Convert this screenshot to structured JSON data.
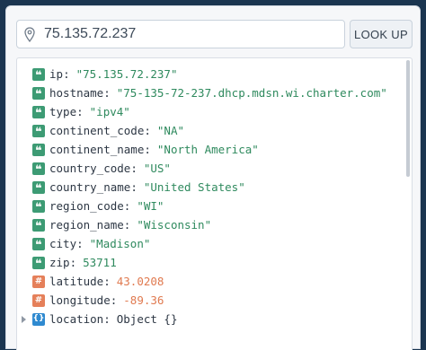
{
  "search": {
    "value": "75.135.72.237",
    "lookup_label": "LOOK UP"
  },
  "colors": {
    "string_badge": "#3d9b74",
    "number_badge": "#e5805a",
    "object_badge": "#2f8ad0",
    "string_value": "#2f8a5e",
    "number_value": "#e07a50"
  },
  "icons": {
    "search": "map-pin-icon",
    "string": "quote-icon",
    "number": "hash-icon",
    "object": "braces-icon"
  },
  "badges": {
    "string": "❝",
    "number": "#",
    "object": "{}"
  },
  "fields": [
    {
      "key": "ip",
      "value": "\"75.135.72.237\"",
      "type": "string"
    },
    {
      "key": "hostname",
      "value": "\"75-135-72-237.dhcp.mdsn.wi.charter.com\"",
      "type": "string"
    },
    {
      "key": "type",
      "value": "\"ipv4\"",
      "type": "string"
    },
    {
      "key": "continent_code",
      "value": "\"NA\"",
      "type": "string"
    },
    {
      "key": "continent_name",
      "value": "\"North America\"",
      "type": "string"
    },
    {
      "key": "country_code",
      "value": "\"US\"",
      "type": "string"
    },
    {
      "key": "country_name",
      "value": "\"United States\"",
      "type": "string"
    },
    {
      "key": "region_code",
      "value": "\"WI\"",
      "type": "string"
    },
    {
      "key": "region_name",
      "value": "\"Wisconsin\"",
      "type": "string"
    },
    {
      "key": "city",
      "value": "\"Madison\"",
      "type": "string"
    },
    {
      "key": "zip",
      "value": "53711",
      "type": "string"
    },
    {
      "key": "latitude",
      "value": "43.0208",
      "type": "number"
    },
    {
      "key": "longitude",
      "value": "-89.36",
      "type": "number"
    },
    {
      "key": "location",
      "value": "Object {}",
      "type": "object"
    }
  ]
}
